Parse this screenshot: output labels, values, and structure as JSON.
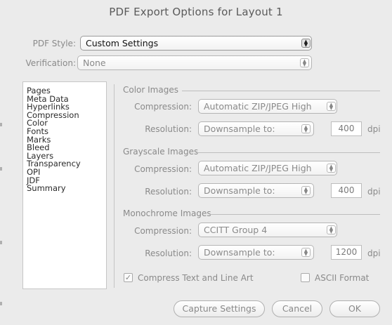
{
  "window": {
    "title": "PDF Export Options for Layout 1"
  },
  "pdf_style": {
    "label": "PDF Style:",
    "value": "Custom Settings"
  },
  "verification": {
    "label": "Verification:",
    "value": "None"
  },
  "sidebar": {
    "items": [
      {
        "label": "Pages"
      },
      {
        "label": "Meta Data"
      },
      {
        "label": "Hyperlinks"
      },
      {
        "label": "Compression"
      },
      {
        "label": "Color"
      },
      {
        "label": "Fonts"
      },
      {
        "label": "Marks"
      },
      {
        "label": "Bleed"
      },
      {
        "label": "Layers"
      },
      {
        "label": "Transparency"
      },
      {
        "label": "OPI"
      },
      {
        "label": "JDF"
      },
      {
        "label": "Summary"
      }
    ]
  },
  "color_images": {
    "title": "Color Images",
    "compression_label": "Compression:",
    "compression_value": "Automatic ZIP/JPEG High",
    "resolution_label": "Resolution:",
    "resolution_value": "Downsample to:",
    "dpi_value": "400",
    "dpi_unit": "dpi"
  },
  "grayscale_images": {
    "title": "Grayscale Images",
    "compression_label": "Compression:",
    "compression_value": "Automatic ZIP/JPEG High",
    "resolution_label": "Resolution:",
    "resolution_value": "Downsample to:",
    "dpi_value": "400",
    "dpi_unit": "dpi"
  },
  "monochrome_images": {
    "title": "Monochrome Images",
    "compression_label": "Compression:",
    "compression_value": "CCITT Group 4",
    "resolution_label": "Resolution:",
    "resolution_value": "Downsample to:",
    "dpi_value": "1200",
    "dpi_unit": "dpi"
  },
  "options": {
    "compress_text": {
      "label": "Compress Text and Line Art",
      "checked": true,
      "mark": "✓"
    },
    "ascii_format": {
      "label": "ASCII Format",
      "checked": false
    }
  },
  "buttons": {
    "capture": "Capture Settings",
    "cancel": "Cancel",
    "ok": "OK"
  },
  "icons": {
    "stepper": "popup-stepper-icon",
    "up": "▲",
    "down": "▼"
  }
}
